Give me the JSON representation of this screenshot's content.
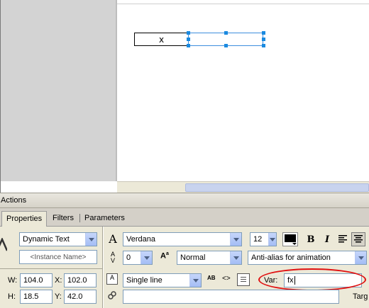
{
  "stage": {
    "static_text_value": "x"
  },
  "actions_panel": {
    "title": "Actions"
  },
  "tabs": [
    {
      "label": "Properties"
    },
    {
      "label": "Filters"
    },
    {
      "label": "Parameters"
    }
  ],
  "properties": {
    "text_type": "Dynamic Text",
    "instance_name_placeholder": "<Instance Name>",
    "font": "Verdana",
    "font_size": "12",
    "letter_spacing": "0",
    "char_position": "Normal",
    "anti_alias": "Anti-alias for animation",
    "line_type": "Single line",
    "w_label": "W:",
    "w_value": "104.0",
    "x_label": "X:",
    "x_value": "102.0",
    "h_label": "H:",
    "h_value": "18.5",
    "y_label": "Y:",
    "y_value": "42.0",
    "var_label": "Var:",
    "var_value": "fx",
    "target_label": "Targ",
    "bold_label": "B",
    "italic_label": "I",
    "text_color": "#000000"
  }
}
